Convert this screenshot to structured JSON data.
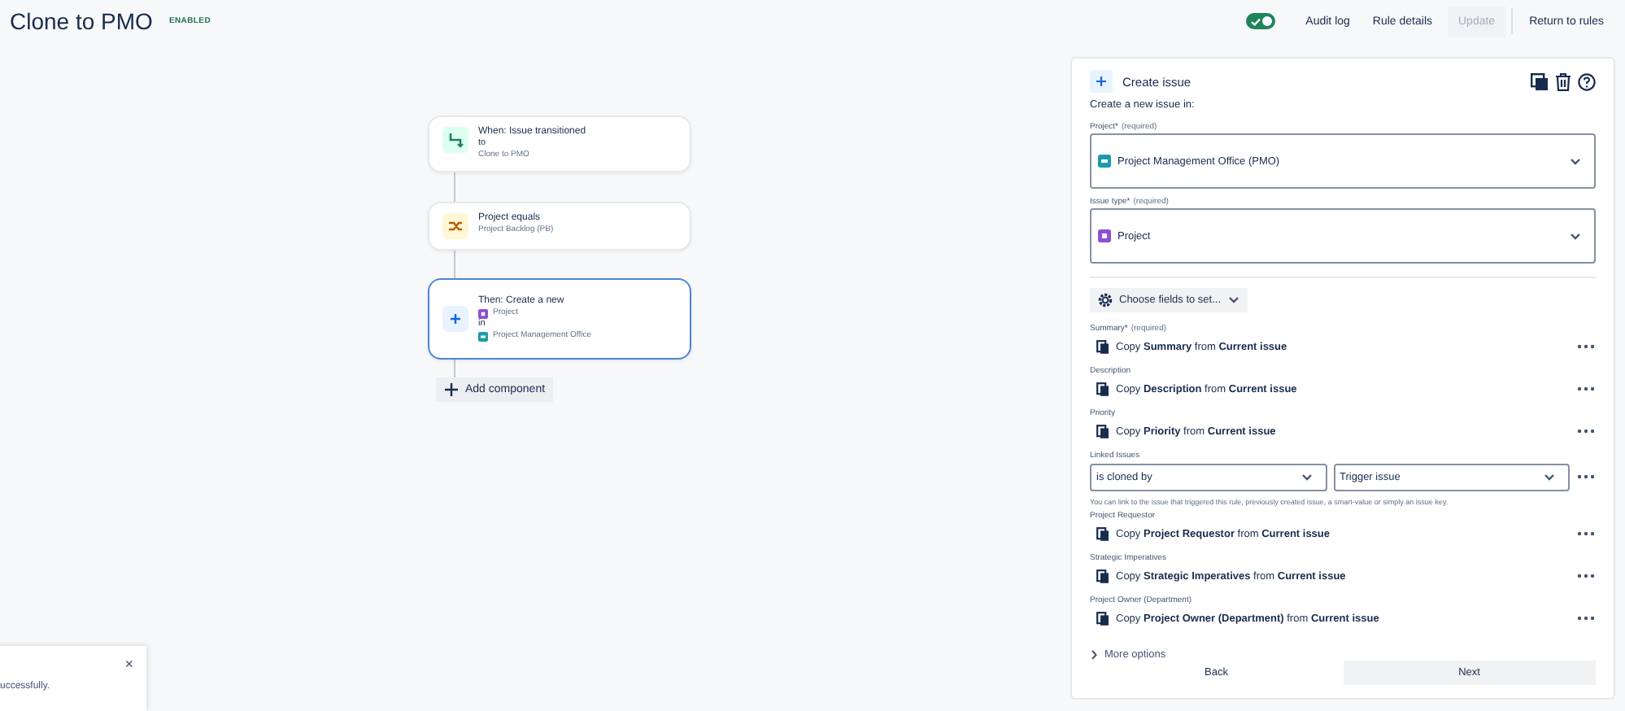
{
  "header": {
    "title": "Clone to PMO",
    "status_badge": "ENABLED",
    "toggle": {
      "on": true
    },
    "links": [
      "Audit log",
      "Rule details"
    ],
    "update_button": {
      "label": "Update",
      "disabled": true
    },
    "return_link": "Return to rules"
  },
  "flow": {
    "nodes": [
      {
        "kind": "trigger",
        "selected": false,
        "title": "When: Issue transitioned",
        "lines": [
          {
            "kind": "text",
            "text": "to",
            "muted": false
          },
          {
            "kind": "text",
            "text": "Clone to PMO",
            "muted": true
          }
        ]
      },
      {
        "kind": "condition",
        "selected": false,
        "title": "Project equals",
        "lines": [
          {
            "kind": "text",
            "text": "Project Backlog (PB)",
            "muted": true
          }
        ]
      },
      {
        "kind": "action",
        "selected": true,
        "title": "Then: Create a new",
        "lines": [
          {
            "kind": "issue-type",
            "text": "Project",
            "muted": true
          },
          {
            "kind": "text",
            "text": "in",
            "muted": false
          },
          {
            "kind": "project",
            "text": "Project Management Office",
            "muted": true
          }
        ]
      }
    ],
    "add_component": "Add component"
  },
  "panel": {
    "title": "Create issue",
    "intro": "Create a new issue in:",
    "selects": [
      {
        "label": "Project*",
        "note": "(required)",
        "value": "Project Management Office (PMO)",
        "kind": "project"
      },
      {
        "label": "Issue type*",
        "note": "(required)",
        "value": "Project",
        "kind": "issue-type"
      }
    ],
    "choose_fields": "Choose fields to set...",
    "fields": [
      {
        "kind": "copy",
        "label": "Summary*",
        "note": "(required)",
        "text": "Copy **Summary** from **Current issue**"
      },
      {
        "kind": "copy",
        "label": "Description",
        "text": "Copy **Description** from **Current issue**"
      },
      {
        "kind": "copy",
        "label": "Priority",
        "text": "Copy **Priority** from **Current issue**"
      },
      {
        "kind": "link",
        "label": "Linked Issues",
        "selects": [
          "is cloned by",
          "Trigger issue"
        ],
        "help": "You can link to the issue that triggered this rule, previously created issue, a smart-value or simply an issue key."
      },
      {
        "kind": "copy",
        "label": "Project Requestor",
        "text": "Copy **Project Requestor** from **Current issue**"
      },
      {
        "kind": "copy",
        "label": "Strategic Imperatives",
        "text": "Copy **Strategic Imperatives** from **Current issue**"
      },
      {
        "kind": "copy",
        "label": "Project Owner (Department)",
        "text": "Copy **Project Owner (Department)** from **Current issue**"
      }
    ],
    "more_options": {
      "label": "More options",
      "expanded": false
    },
    "buttons": [
      "Back",
      "Next"
    ]
  },
  "toast": {
    "text": "uccessfully.",
    "close": "×"
  }
}
